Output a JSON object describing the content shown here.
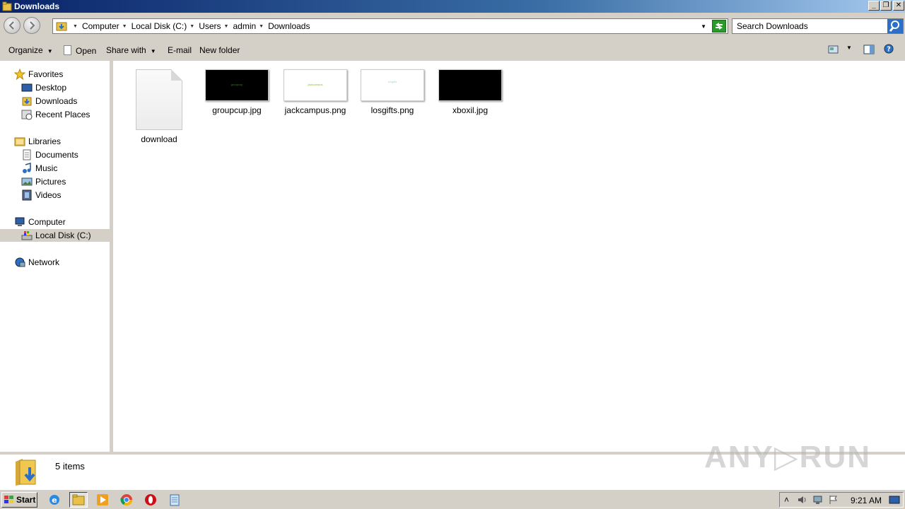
{
  "window": {
    "title": "Downloads"
  },
  "titlebar_buttons": {
    "minimize": "_",
    "restore": "❐",
    "close": "✕"
  },
  "address": {
    "crumbs": [
      "Computer",
      "Local Disk (C:)",
      "Users",
      "admin",
      "Downloads"
    ],
    "search_placeholder": "Search Downloads"
  },
  "toolbar": {
    "organize": "Organize",
    "open": "Open",
    "share_with": "Share with",
    "email": "E-mail",
    "new_folder": "New folder"
  },
  "nav": {
    "favorites": "Favorites",
    "favorites_items": [
      "Desktop",
      "Downloads",
      "Recent Places"
    ],
    "libraries": "Libraries",
    "libraries_items": [
      "Documents",
      "Music",
      "Pictures",
      "Videos"
    ],
    "computer": "Computer",
    "computer_items": [
      "Local Disk (C:)"
    ],
    "network": "Network"
  },
  "files": [
    {
      "name": "download",
      "kind": "document"
    },
    {
      "name": "groupcup.jpg",
      "kind": "image",
      "bg": "#000000",
      "caption": "groupcup",
      "caption_color": "#3a7a2a"
    },
    {
      "name": "jackcampus.png",
      "kind": "image",
      "bg": "#ffffff",
      "caption": "jackcampus",
      "caption_color": "#8bbf3a"
    },
    {
      "name": "losgifts.png",
      "kind": "image",
      "bg": "#ffffff",
      "caption": "losgifts",
      "caption_color": "#a6d8d8"
    },
    {
      "name": "xboxil.jpg",
      "kind": "image",
      "bg": "#000000",
      "caption": "",
      "caption_color": "#333333"
    }
  ],
  "details": {
    "count": "5 items"
  },
  "watermark": "ANY▷RUN",
  "taskbar": {
    "start": "Start",
    "clock": "9:21 AM"
  },
  "colors": {
    "selection": "#d4d0c8",
    "titlebar": "#0a246a"
  }
}
